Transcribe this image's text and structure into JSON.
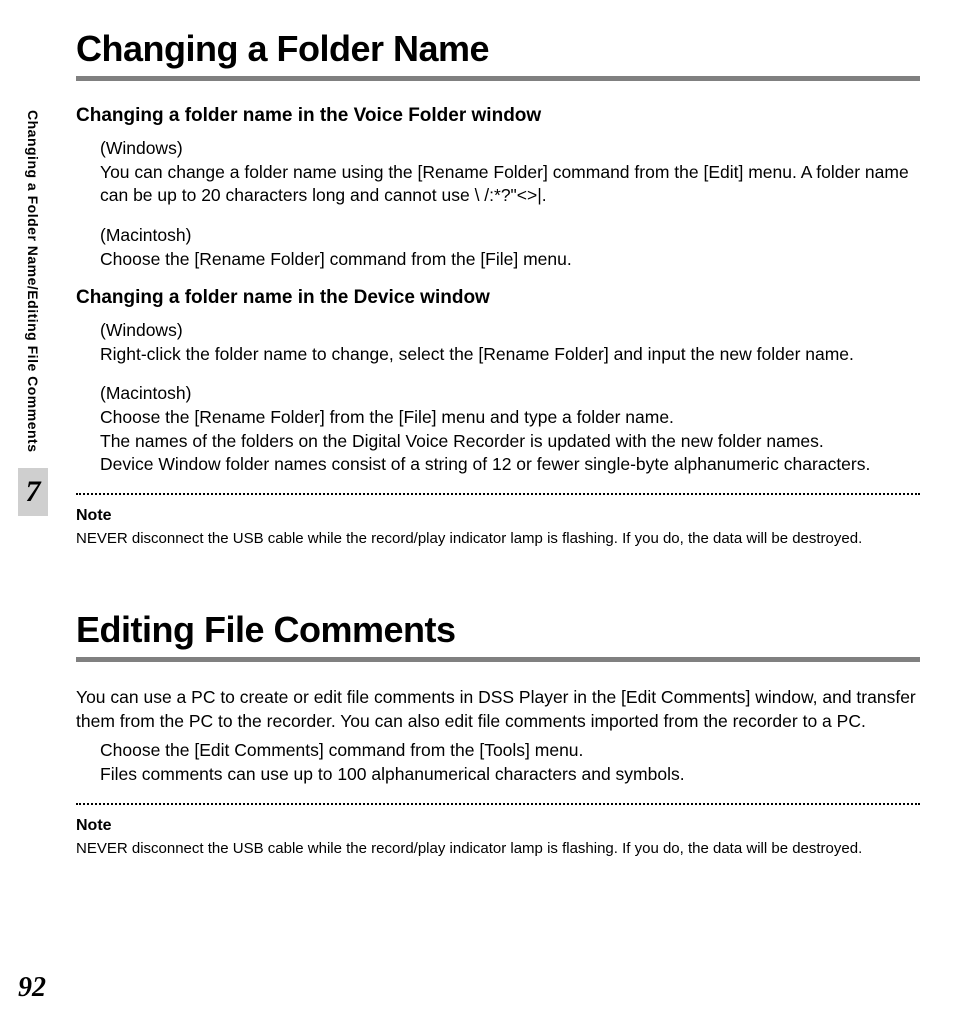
{
  "sidebar": {
    "text": "Changing a Folder Name/Editing File Comments",
    "chapter": "7"
  },
  "section1": {
    "title": "Changing a Folder Name",
    "sub1": {
      "heading": "Changing a folder name in the Voice Folder window",
      "win_label": "(Windows)",
      "win_body": "You can change a folder name using the [Rename Folder] command from the [Edit] menu. A folder name can be up to 20 characters long and cannot use \\ /:*?\"<>|.",
      "mac_label": "(Macintosh)",
      "mac_body": "Choose the [Rename Folder] command from the [File] menu."
    },
    "sub2": {
      "heading": "Changing a folder name in the Device window",
      "win_label": "(Windows)",
      "win_body": "Right-click the folder name to change, select the [Rename Folder] and input the new folder name.",
      "mac_label": "(Macintosh)",
      "mac_body1": "Choose the [Rename Folder] from the [File] menu and type a folder name.",
      "mac_body2": "The names of the folders on the Digital Voice Recorder is updated with the new folder names.",
      "mac_body3": "Device Window folder names consist of a string of 12 or fewer single-byte alphanumeric characters."
    },
    "note_heading": "Note",
    "note_body": "NEVER disconnect the USB cable while the record/play indicator lamp is flashing. If you do, the data will be destroyed."
  },
  "section2": {
    "title": "Editing File Comments",
    "intro": "You can use a PC to create or edit file comments in DSS Player in the [Edit Comments] window, and transfer them from the PC to the recorder. You can also edit file comments imported from the recorder to a PC.",
    "step1": "Choose the [Edit Comments] command from the [Tools] menu.",
    "step2": "Files comments can use up to 100 alphanumerical characters and symbols.",
    "note_heading": "Note",
    "note_body": "NEVER disconnect the USB cable while the record/play indicator lamp is flashing. If you do, the data will be destroyed."
  },
  "page_number": "92"
}
